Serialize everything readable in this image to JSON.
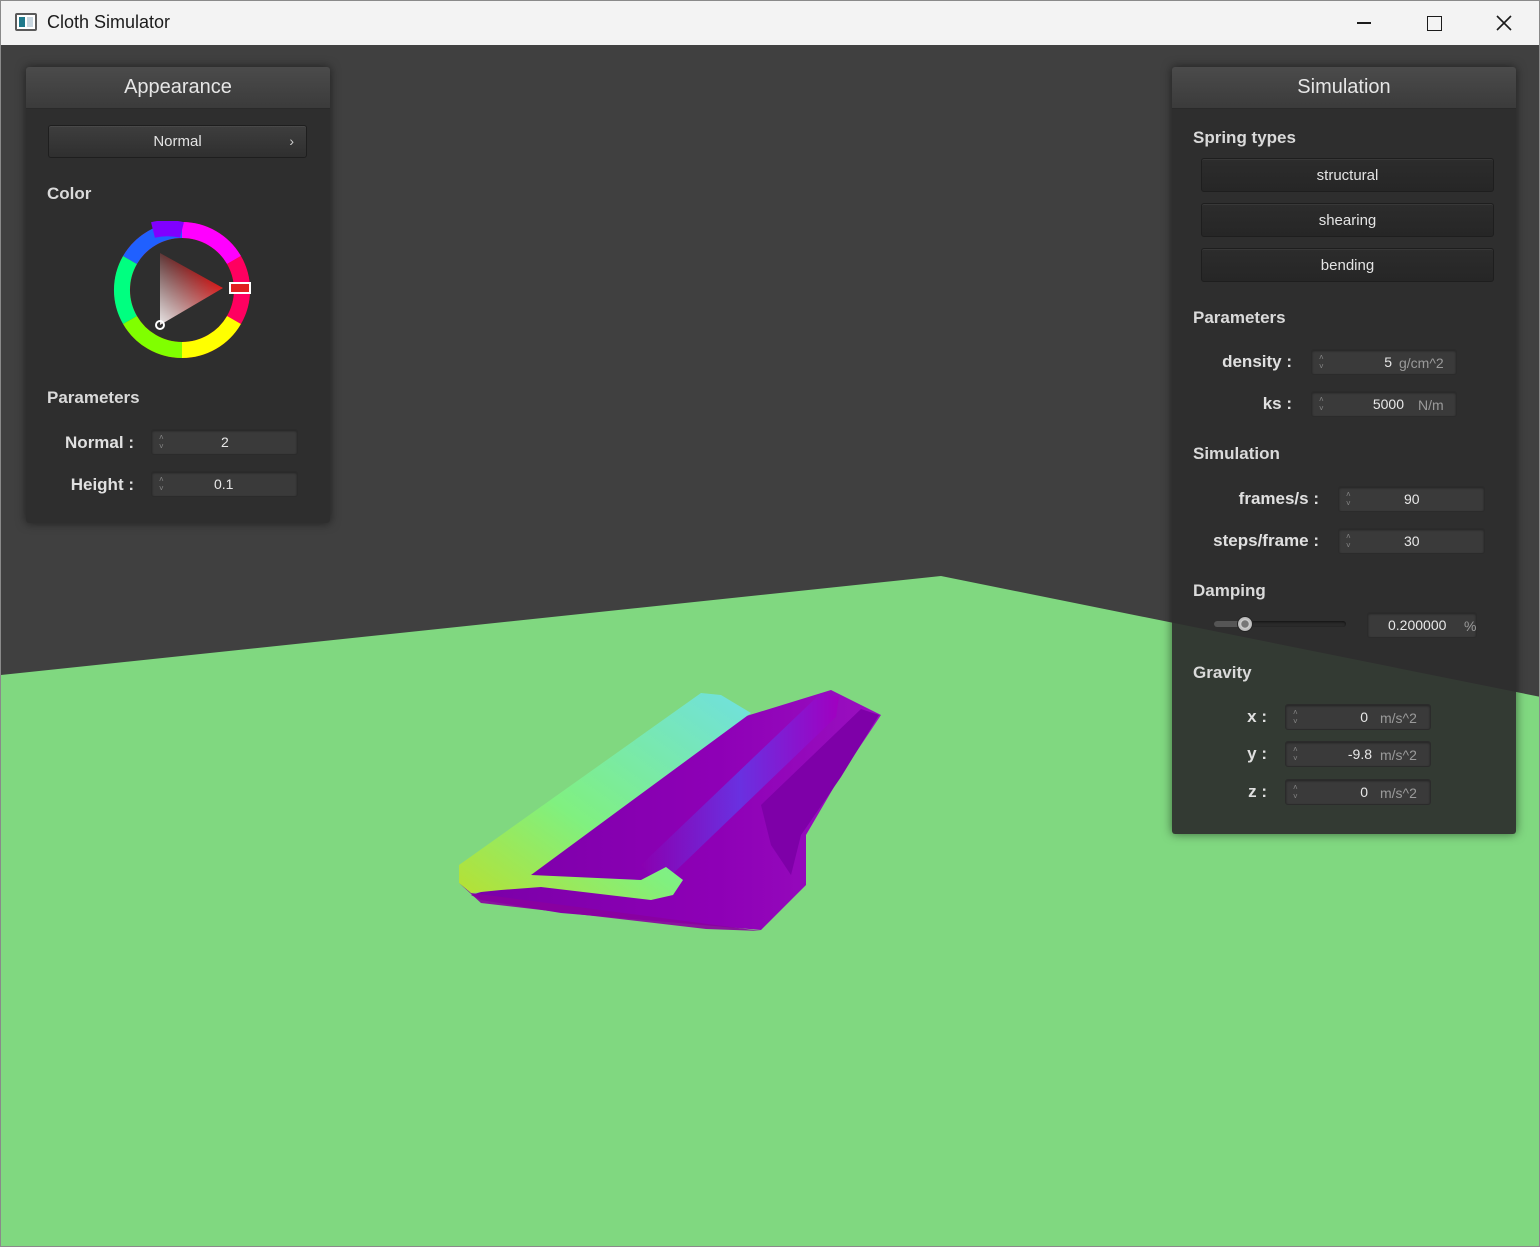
{
  "window": {
    "title": "Cloth Simulator"
  },
  "appearance": {
    "header": "Appearance",
    "shader": {
      "selected": "Normal"
    },
    "color_label": "Color",
    "color_value": "#e02020",
    "parameters_label": "Parameters",
    "normal": {
      "label": "Normal :",
      "value": "2"
    },
    "height": {
      "label": "Height :",
      "value": "0.1"
    }
  },
  "simulation": {
    "header": "Simulation",
    "spring_types_label": "Spring types",
    "springs": [
      "structural",
      "shearing",
      "bending"
    ],
    "parameters_label": "Parameters",
    "density": {
      "label": "density :",
      "value": "5",
      "unit": "g/cm^2"
    },
    "ks": {
      "label": "ks :",
      "value": "5000",
      "unit": "N/m"
    },
    "simulation_label": "Simulation",
    "fps": {
      "label": "frames/s :",
      "value": "90"
    },
    "steps": {
      "label": "steps/frame :",
      "value": "30"
    },
    "damping_label": "Damping",
    "damping": {
      "value": "0.200000",
      "unit": "%",
      "fraction": 0.2
    },
    "gravity_label": "Gravity",
    "gx": {
      "label": "x :",
      "value": "0",
      "unit": "m/s^2"
    },
    "gy": {
      "label": "y :",
      "value": "-9.8",
      "unit": "m/s^2"
    },
    "gz": {
      "label": "z :",
      "value": "0",
      "unit": "m/s^2"
    }
  },
  "colors": {
    "floor": "#80d880",
    "background": "#404040",
    "cloth": "#8c00b0"
  }
}
